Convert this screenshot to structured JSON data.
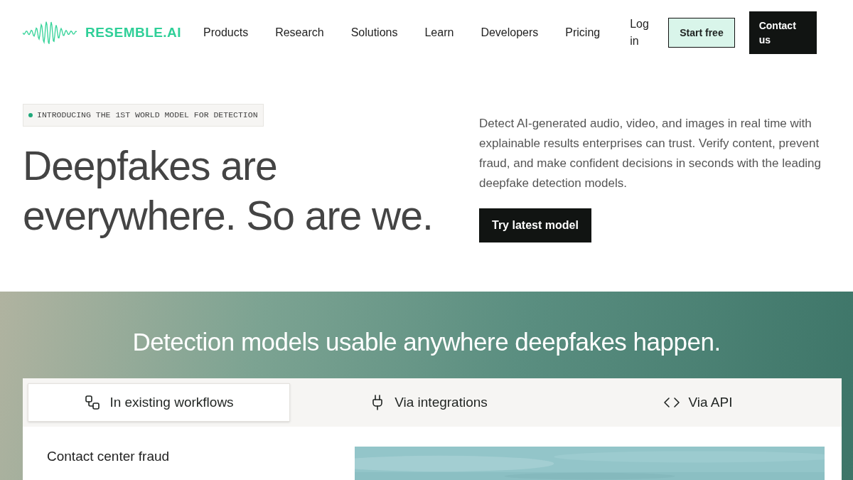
{
  "nav": {
    "logo": "RESEMBLE.AI",
    "links": [
      "Products",
      "Research",
      "Solutions",
      "Learn",
      "Developers",
      "Pricing",
      "Log in"
    ],
    "buttons": [
      {
        "label": "Start free",
        "kind": "outline"
      },
      {
        "label": "Contact us",
        "kind": "solid"
      }
    ]
  },
  "hero": {
    "badge": "INTRODUCING THE 1ST WORLD MODEL FOR DETECTION",
    "heading": "Deepfakes are everywhere. So are we.",
    "description": "Detect AI-generated audio, video, and images in real time with explainable results enterprises can trust. Verify content, prevent fraud, and make confident decisions in seconds with the leading deepfake detection models.",
    "cta": "Try latest model"
  },
  "section": {
    "heading": "Detection models usable anywhere deepfakes happen.",
    "tabs": [
      {
        "label": "In existing workflows",
        "kind": "workflow",
        "selected": true
      },
      {
        "label": "Via integrations",
        "kind": "plug",
        "selected": false
      },
      {
        "label": "Via API",
        "kind": "code",
        "selected": false
      }
    ],
    "use_case": "Contact center fraud"
  }
}
